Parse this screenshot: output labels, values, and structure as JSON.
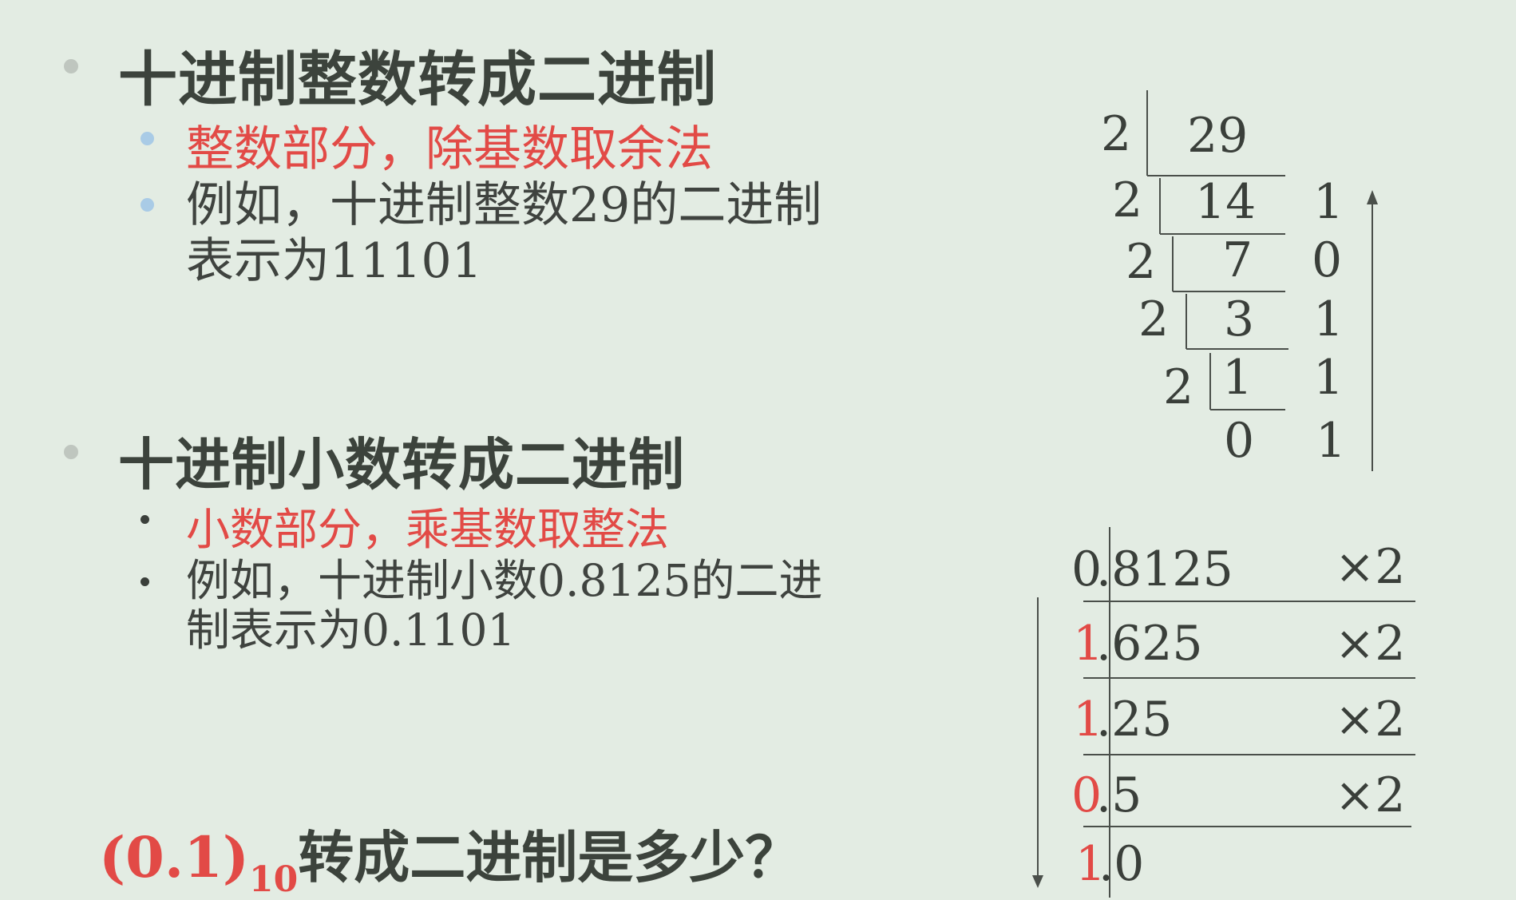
{
  "section1": {
    "heading": "十进制整数转成二进制",
    "bullet_red": "整数部分，除基数取余法",
    "bullet_line1": "例如，十进制整数29的二进制",
    "bullet_line2": "表示为11101"
  },
  "section2": {
    "heading": "十进制小数转成二进制",
    "bullet_red": "小数部分，乘基数取整法",
    "bullet_line1": "例如，十进制小数0.8125的二进",
    "bullet_line2": "制表示为0.1101"
  },
  "question": {
    "value": "(0.1)",
    "subscript": "10",
    "text": "转成二进制是多少？"
  },
  "division": {
    "divisor": "2",
    "rows": [
      {
        "divisor": "2",
        "quotient": "29",
        "remainder": ""
      },
      {
        "divisor": "2",
        "quotient": "14",
        "remainder": "1"
      },
      {
        "divisor": "2",
        "quotient": "7",
        "remainder": "0"
      },
      {
        "divisor": "2",
        "quotient": "3",
        "remainder": "1"
      },
      {
        "divisor": "2",
        "quotient": "1",
        "remainder": "1"
      },
      {
        "divisor": "",
        "quotient": "0",
        "remainder": "1"
      }
    ]
  },
  "multiplication": {
    "rows": [
      {
        "int": "0",
        "frac": ".8125",
        "op": "×2",
        "int_red": false
      },
      {
        "int": "1",
        "frac": ".625",
        "op": "×2",
        "int_red": true
      },
      {
        "int": "1",
        "frac": ".25",
        "op": "×2",
        "int_red": true
      },
      {
        "int": "0",
        "frac": ".5",
        "op": "×2",
        "int_red": true
      },
      {
        "int": "1",
        "frac": ".0",
        "op": "",
        "int_red": true
      }
    ]
  },
  "colors": {
    "background": "#e3ece3",
    "accent_red": "#e24a46",
    "text": "#3a3f3a",
    "bullet_gray": "#bfc6bf",
    "bullet_blue": "#a9cbe6"
  }
}
